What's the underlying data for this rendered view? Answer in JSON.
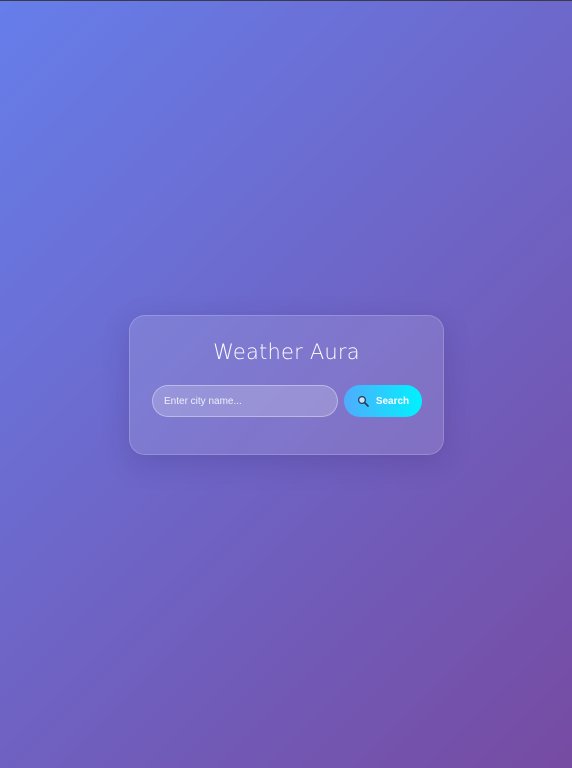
{
  "app": {
    "title": "Weather Aura"
  },
  "search": {
    "placeholder": "Enter city name...",
    "value": "",
    "button_label": "Search",
    "button_icon": "search-icon"
  },
  "colors": {
    "background_start": "#667eea",
    "background_end": "#764ba2",
    "button_start": "#4facfe",
    "button_end": "#00f2fe"
  }
}
